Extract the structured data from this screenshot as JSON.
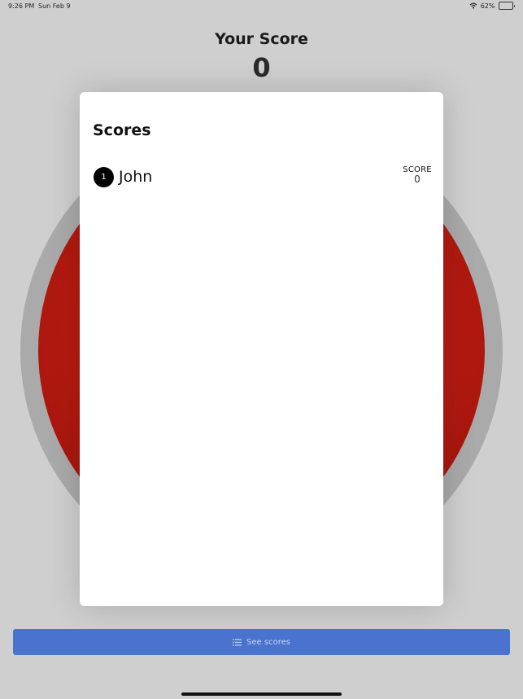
{
  "status_bar": {
    "time": "9:26 PM",
    "date": "Sun Feb 9",
    "battery_percent": "62%",
    "battery_level": 0.62
  },
  "header": {
    "title": "Your Score",
    "score": "0"
  },
  "modal": {
    "title": "Scores",
    "rows": [
      {
        "rank": "1",
        "name": "John",
        "score_label": "SCORE",
        "score": "0"
      }
    ]
  },
  "footer": {
    "see_scores_label": "See scores"
  },
  "colors": {
    "primary_button": "#4a72cf",
    "red_button": "#b41a10"
  }
}
